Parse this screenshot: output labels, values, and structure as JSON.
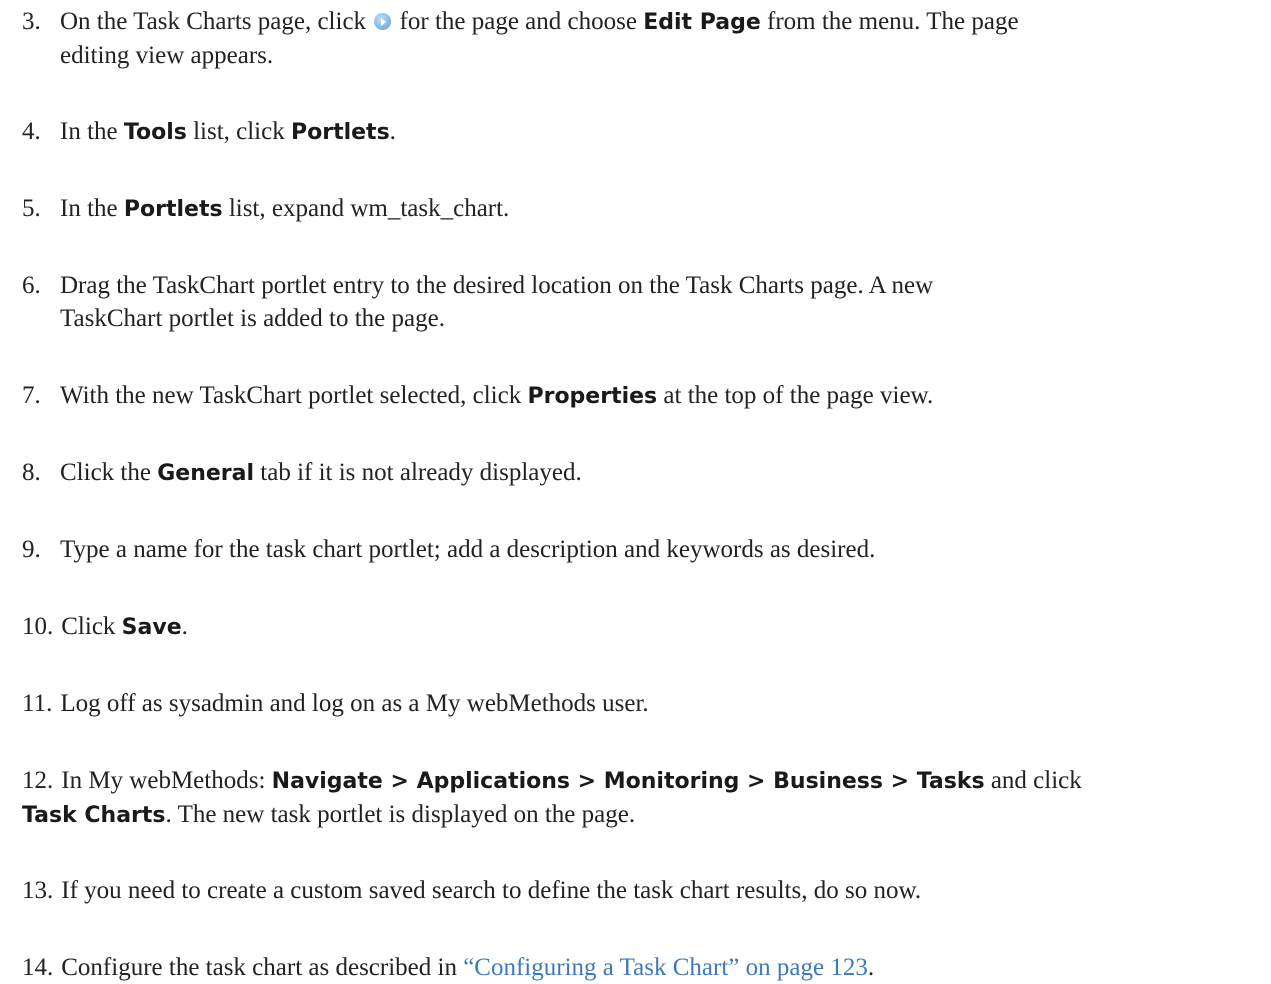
{
  "steps": [
    {
      "num": "3.",
      "lines": [
        [
          "On the Task Charts page, click ",
          {
            "icon": "play-menu-icon"
          },
          " for the page and choose ",
          {
            "ui": "Edit Page"
          },
          " from the menu. The page"
        ],
        [
          "editing view appears."
        ]
      ]
    },
    {
      "num": "4.",
      "lines": [
        [
          "In the ",
          {
            "ui": "Tools"
          },
          " list, click ",
          {
            "ui": "Portlets"
          },
          "."
        ]
      ]
    },
    {
      "num": "5.",
      "lines": [
        [
          "In the ",
          {
            "ui": "Portlets"
          },
          " list, expand wm_task_chart."
        ]
      ]
    },
    {
      "num": "6.",
      "lines": [
        [
          "Drag the TaskChart portlet entry to the desired location on the Task Charts page. A new"
        ],
        [
          "TaskChart portlet is added to the page."
        ]
      ]
    },
    {
      "num": "7.",
      "lines": [
        [
          "With the new TaskChart portlet selected, click ",
          {
            "ui": "Properties"
          },
          " at the top of the page view."
        ]
      ]
    },
    {
      "num": "8.",
      "lines": [
        [
          "Click the ",
          {
            "ui": "General"
          },
          " tab if it is not already displayed."
        ]
      ]
    },
    {
      "num": "9.",
      "lines": [
        [
          "Type a name for the task chart portlet; add a description and keywords as desired."
        ]
      ]
    },
    {
      "num": "10.",
      "lines": [
        [
          "Click ",
          {
            "ui": "Save"
          },
          "."
        ]
      ]
    },
    {
      "num": "11.",
      "lines": [
        [
          "Log off as sysadmin and log on as a My webMethods user."
        ]
      ]
    },
    {
      "num": "12.",
      "lines": [
        [
          "In My webMethods: ",
          {
            "ui": "Navigate > Applications > Monitoring > Business > Tasks"
          },
          " and click"
        ],
        [
          {
            "ui": "Task Charts"
          },
          ". The new task portlet is displayed on the page."
        ]
      ]
    },
    {
      "num": "13.",
      "lines": [
        [
          "If you need to create a custom saved search to define the task chart results, do so now."
        ]
      ]
    },
    {
      "num": "14.",
      "lines": [
        [
          "Configure the task chart as described in ",
          {
            "link": "“Configuring a Task Chart” on page 123"
          },
          "."
        ]
      ]
    }
  ],
  "colors": {
    "body_text": "#222222",
    "link": "#3f7ab8",
    "icon_blue": "#8bbbe3"
  }
}
